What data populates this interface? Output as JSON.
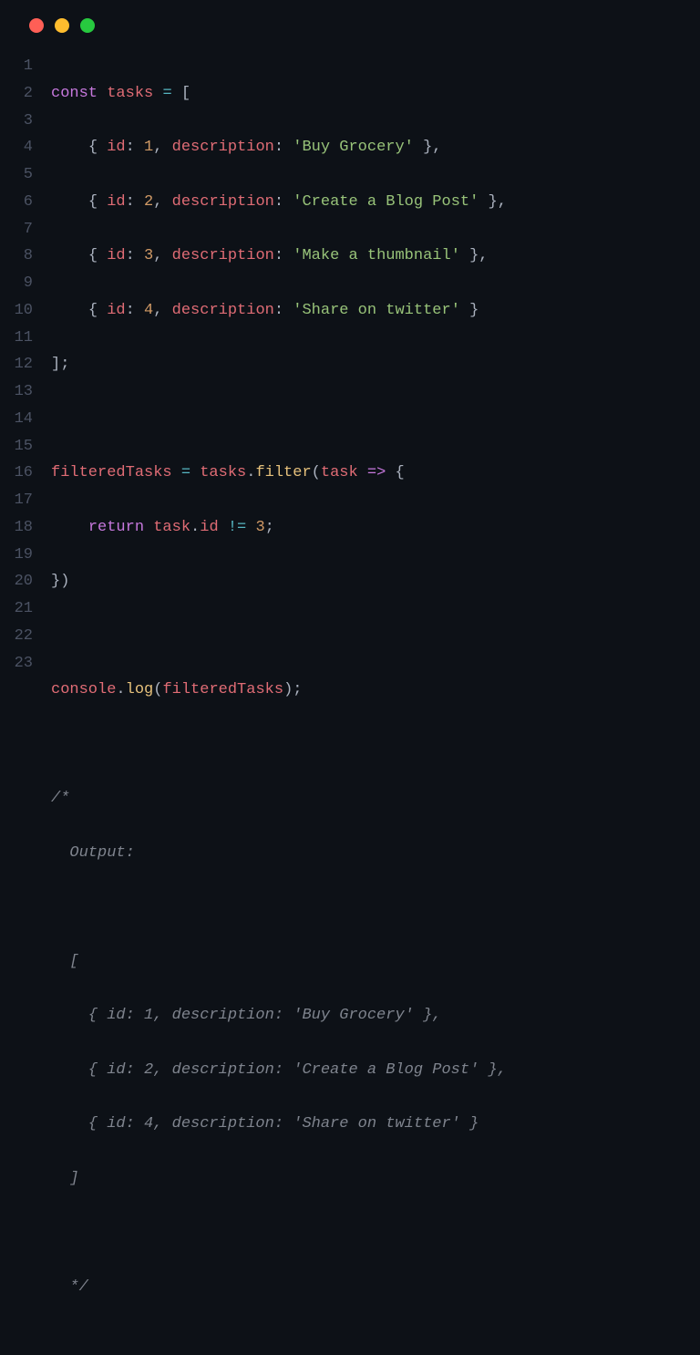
{
  "traffic_lights": [
    "red",
    "yellow",
    "green"
  ],
  "line_numbers": [
    "1",
    "2",
    "3",
    "4",
    "5",
    "6",
    "7",
    "8",
    "9",
    "10",
    "11",
    "12",
    "13",
    "14",
    "15",
    "16",
    "17",
    "18",
    "19",
    "20",
    "21",
    "22",
    "23"
  ],
  "code": {
    "l1": {
      "kw": "const",
      "sp": " ",
      "var": "tasks",
      "sp2": " ",
      "op": "=",
      "sp3": " ",
      "pn": "["
    },
    "l2": {
      "indent": "    ",
      "pn1": "{ ",
      "prop1": "id",
      "pn2": ": ",
      "num": "1",
      "pn3": ", ",
      "prop2": "description",
      "pn4": ": ",
      "str": "'Buy Grocery'",
      "pn5": " },"
    },
    "l3": {
      "indent": "    ",
      "pn1": "{ ",
      "prop1": "id",
      "pn2": ": ",
      "num": "2",
      "pn3": ", ",
      "prop2": "description",
      "pn4": ": ",
      "str": "'Create a Blog Post'",
      "pn5": " },"
    },
    "l4": {
      "indent": "    ",
      "pn1": "{ ",
      "prop1": "id",
      "pn2": ": ",
      "num": "3",
      "pn3": ", ",
      "prop2": "description",
      "pn4": ": ",
      "str": "'Make a thumbnail'",
      "pn5": " },"
    },
    "l5": {
      "indent": "    ",
      "pn1": "{ ",
      "prop1": "id",
      "pn2": ": ",
      "num": "4",
      "pn3": ", ",
      "prop2": "description",
      "pn4": ": ",
      "str": "'Share on twitter'",
      "pn5": " }"
    },
    "l6": {
      "pn": "];"
    },
    "l7": {
      "blank": ""
    },
    "l8": {
      "var": "filteredTasks",
      "sp": " ",
      "op": "=",
      "sp2": " ",
      "var2": "tasks",
      "pn": ".",
      "call": "filter",
      "pn2": "(",
      "param": "task",
      "sp3": " ",
      "arrow": "=>",
      "sp4": " ",
      "pn3": "{"
    },
    "l9": {
      "indent": "    ",
      "kw": "return",
      "sp": " ",
      "var": "task",
      "pn": ".",
      "prop": "id",
      "sp2": " ",
      "op": "!=",
      "sp3": " ",
      "num": "3",
      "pn2": ";"
    },
    "l10": {
      "pn": "})"
    },
    "l11": {
      "blank": ""
    },
    "l12": {
      "var": "console",
      "pn": ".",
      "call": "log",
      "pn2": "(",
      "arg": "filteredTasks",
      "pn3": ");"
    },
    "l13": {
      "blank": ""
    },
    "l14": {
      "cmt": "/*"
    },
    "l15": {
      "cmt": "  Output:"
    },
    "l16": {
      "blank": ""
    },
    "l17": {
      "cmt": "  ["
    },
    "l18": {
      "cmt": "    { id: 1, description: 'Buy Grocery' },"
    },
    "l19": {
      "cmt": "    { id: 2, description: 'Create a Blog Post' },"
    },
    "l20": {
      "cmt": "    { id: 4, description: 'Share on twitter' }"
    },
    "l21": {
      "cmt": "  ]"
    },
    "l22": {
      "blank": ""
    },
    "l23": {
      "cmt": "  */"
    }
  }
}
